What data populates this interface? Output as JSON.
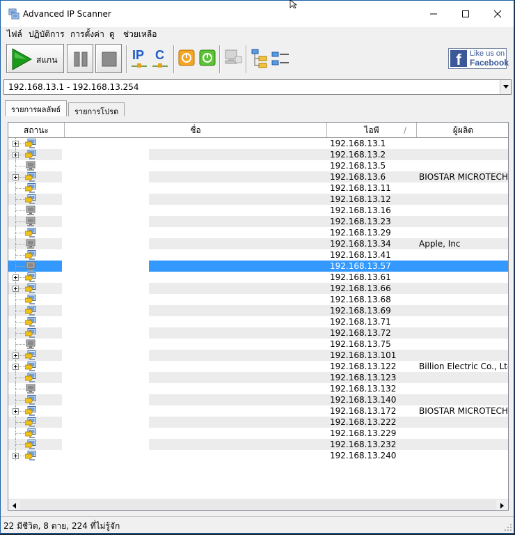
{
  "window": {
    "title": "Advanced IP Scanner"
  },
  "menu": [
    "ไฟล์",
    "ปฏิบัติการ",
    "การตั้งค่า",
    "ดู",
    "ช่วยเหลือ"
  ],
  "toolbar": {
    "scan_label": "สแกน",
    "ip_label": "IP",
    "c_label": "C",
    "facebook_line1": "Like us on",
    "facebook_line2": "Facebook",
    "facebook_letter": "f"
  },
  "range": {
    "value": "192.168.13.1 - 192.168.13.254"
  },
  "tabs": [
    "รายการผลลัพธ์",
    "รายการโปรด"
  ],
  "table": {
    "columns": [
      "สถานะ",
      "ชื่อ",
      "ไอพี",
      "ผู้ผลิต"
    ],
    "sort_glyph": "∕",
    "rows": [
      {
        "ip": "192.168.13.1",
        "maker": "",
        "expand": true,
        "status": "alive"
      },
      {
        "ip": "192.168.13.2",
        "maker": "",
        "expand": true,
        "status": "alive"
      },
      {
        "ip": "192.168.13.5",
        "maker": "",
        "expand": false,
        "status": "dead"
      },
      {
        "ip": "192.168.13.6",
        "maker": "BIOSTAR MICROTECH INT",
        "expand": true,
        "status": "alive"
      },
      {
        "ip": "192.168.13.11",
        "maker": "",
        "expand": false,
        "status": "alive"
      },
      {
        "ip": "192.168.13.12",
        "maker": "",
        "expand": false,
        "status": "alive"
      },
      {
        "ip": "192.168.13.16",
        "maker": "",
        "expand": false,
        "status": "dead"
      },
      {
        "ip": "192.168.13.23",
        "maker": "",
        "expand": false,
        "status": "dead"
      },
      {
        "ip": "192.168.13.29",
        "maker": "",
        "expand": false,
        "status": "alive"
      },
      {
        "ip": "192.168.13.34",
        "maker": "Apple, Inc",
        "expand": false,
        "status": "dead"
      },
      {
        "ip": "192.168.13.41",
        "maker": "",
        "expand": false,
        "status": "alive"
      },
      {
        "ip": "192.168.13.57",
        "maker": "",
        "expand": false,
        "status": "dead",
        "selected": true
      },
      {
        "ip": "192.168.13.61",
        "maker": "",
        "expand": true,
        "status": "alive"
      },
      {
        "ip": "192.168.13.66",
        "maker": "",
        "expand": true,
        "status": "alive"
      },
      {
        "ip": "192.168.13.68",
        "maker": "",
        "expand": false,
        "status": "alive"
      },
      {
        "ip": "192.168.13.69",
        "maker": "",
        "expand": false,
        "status": "alive"
      },
      {
        "ip": "192.168.13.71",
        "maker": "",
        "expand": false,
        "status": "alive"
      },
      {
        "ip": "192.168.13.72",
        "maker": "",
        "expand": false,
        "status": "alive"
      },
      {
        "ip": "192.168.13.75",
        "maker": "",
        "expand": false,
        "status": "dead"
      },
      {
        "ip": "192.168.13.101",
        "maker": "",
        "expand": true,
        "status": "alive"
      },
      {
        "ip": "192.168.13.122",
        "maker": "Billion Electric Co., Ltd.",
        "expand": true,
        "status": "alive"
      },
      {
        "ip": "192.168.13.123",
        "maker": "",
        "expand": false,
        "status": "alive"
      },
      {
        "ip": "192.168.13.132",
        "maker": "",
        "expand": false,
        "status": "dead"
      },
      {
        "ip": "192.168.13.140",
        "maker": "",
        "expand": false,
        "status": "alive"
      },
      {
        "ip": "192.168.13.172",
        "maker": "BIOSTAR MICROTECH INT",
        "expand": true,
        "status": "alive"
      },
      {
        "ip": "192.168.13.222",
        "maker": "",
        "expand": false,
        "status": "alive"
      },
      {
        "ip": "192.168.13.229",
        "maker": "",
        "expand": false,
        "status": "alive"
      },
      {
        "ip": "192.168.13.232",
        "maker": "",
        "expand": false,
        "status": "alive"
      },
      {
        "ip": "192.168.13.240",
        "maker": "",
        "expand": true,
        "status": "alive"
      }
    ]
  },
  "status": {
    "text": "22 มีชีวิต, 8 ตาย, 224 ที่ไม่รู้จัก"
  },
  "colors": {
    "selection": "#3399ff",
    "facebook": "#3b5998",
    "play": "#1a9a1a"
  }
}
